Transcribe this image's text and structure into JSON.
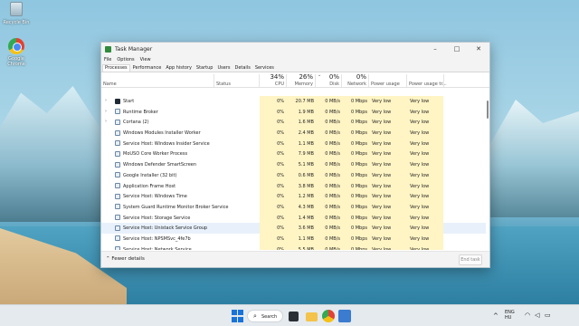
{
  "desktop": {
    "icons": [
      {
        "label": "Recycle Bin",
        "icon": "recycle-bin-icon"
      },
      {
        "label": "Google Chrome",
        "icon": "chrome-icon"
      }
    ]
  },
  "window": {
    "title": "Task Manager",
    "controls": {
      "minimize": "–",
      "maximize": "□",
      "close": "✕"
    },
    "menu": [
      "File",
      "Options",
      "View"
    ],
    "tabs": [
      "Processes",
      "Performance",
      "App history",
      "Startup",
      "Users",
      "Details",
      "Services"
    ],
    "active_tab": "Processes",
    "header": {
      "name": "Name",
      "status": "Status",
      "cpu_pct": "34%",
      "cpu_label": "CPU",
      "memory_pct": "26%",
      "memory_label": "Memory",
      "disk_pct": "0%",
      "disk_label": "Disk",
      "network_pct": "0%",
      "network_label": "Network",
      "power_label": "Power usage",
      "power_trend_label": "Power usage tr..."
    },
    "rows": [
      {
        "name": "Start",
        "expandable": true,
        "cpu": "0%",
        "memory": "20.7 MB",
        "disk": "0 MB/s",
        "network": "0 Mbps",
        "power": "Very low",
        "trend": "Very low"
      },
      {
        "name": "Runtime Broker",
        "expandable": true,
        "cpu": "0%",
        "memory": "1.9 MB",
        "disk": "0 MB/s",
        "network": "0 Mbps",
        "power": "Very low",
        "trend": "Very low"
      },
      {
        "name": "Cortana (2)",
        "expandable": true,
        "cpu": "0%",
        "memory": "1.6 MB",
        "disk": "0 MB/s",
        "network": "0 Mbps",
        "power": "Very low",
        "trend": "Very low"
      },
      {
        "name": "Windows Modules Installer Worker",
        "expandable": false,
        "cpu": "0%",
        "memory": "2.4 MB",
        "disk": "0 MB/s",
        "network": "0 Mbps",
        "power": "Very low",
        "trend": "Very low"
      },
      {
        "name": "Service Host: Windows Insider Service",
        "expandable": false,
        "cpu": "0%",
        "memory": "1.1 MB",
        "disk": "0 MB/s",
        "network": "0 Mbps",
        "power": "Very low",
        "trend": "Very low"
      },
      {
        "name": "MoUSO Core Worker Process",
        "expandable": false,
        "cpu": "0%",
        "memory": "7.9 MB",
        "disk": "0 MB/s",
        "network": "0 Mbps",
        "power": "Very low",
        "trend": "Very low"
      },
      {
        "name": "Windows Defender SmartScreen",
        "expandable": false,
        "cpu": "0%",
        "memory": "5.1 MB",
        "disk": "0 MB/s",
        "network": "0 Mbps",
        "power": "Very low",
        "trend": "Very low"
      },
      {
        "name": "Google Installer (32 bit)",
        "expandable": false,
        "cpu": "0%",
        "memory": "0.6 MB",
        "disk": "0 MB/s",
        "network": "0 Mbps",
        "power": "Very low",
        "trend": "Very low"
      },
      {
        "name": "Application Frame Host",
        "expandable": false,
        "cpu": "0%",
        "memory": "3.8 MB",
        "disk": "0 MB/s",
        "network": "0 Mbps",
        "power": "Very low",
        "trend": "Very low"
      },
      {
        "name": "Service Host: Windows Time",
        "expandable": false,
        "cpu": "0%",
        "memory": "1.2 MB",
        "disk": "0 MB/s",
        "network": "0 Mbps",
        "power": "Very low",
        "trend": "Very low"
      },
      {
        "name": "System Guard Runtime Monitor Broker Service",
        "expandable": false,
        "cpu": "0%",
        "memory": "4.3 MB",
        "disk": "0 MB/s",
        "network": "0 Mbps",
        "power": "Very low",
        "trend": "Very low"
      },
      {
        "name": "Service Host: Storage Service",
        "expandable": false,
        "cpu": "0%",
        "memory": "1.4 MB",
        "disk": "0 MB/s",
        "network": "0 Mbps",
        "power": "Very low",
        "trend": "Very low"
      },
      {
        "name": "Service Host: Unistack Service Group",
        "expandable": false,
        "cpu": "0%",
        "memory": "3.6 MB",
        "disk": "0 MB/s",
        "network": "0 Mbps",
        "power": "Very low",
        "trend": "Very low"
      },
      {
        "name": "Service Host: NPSMSvc_4fe7b",
        "expandable": false,
        "cpu": "0%",
        "memory": "1.1 MB",
        "disk": "0 MB/s",
        "network": "0 Mbps",
        "power": "Very low",
        "trend": "Very low"
      },
      {
        "name": "Service Host: Network Service",
        "expandable": false,
        "cpu": "0%",
        "memory": "5.5 MB",
        "disk": "0 MB/s",
        "network": "0 Mbps",
        "power": "Very low",
        "trend": "Very low"
      }
    ],
    "highlighted_row": "Service Host: Unistack Service Group",
    "fewer_details": "Fewer details",
    "end_task": "End task"
  },
  "taskbar": {
    "search_label": "Search",
    "apps": [
      "start-icon",
      "search-icon",
      "task-view-icon",
      "file-explorer-icon",
      "chrome-icon",
      "task-manager-icon"
    ],
    "tray": {
      "language_1": "ENG",
      "language_2": "HU"
    }
  },
  "colors": {
    "heat": "#fff4c4",
    "accent": "#1a73d9",
    "row_highlight": "#e8f1fb"
  }
}
